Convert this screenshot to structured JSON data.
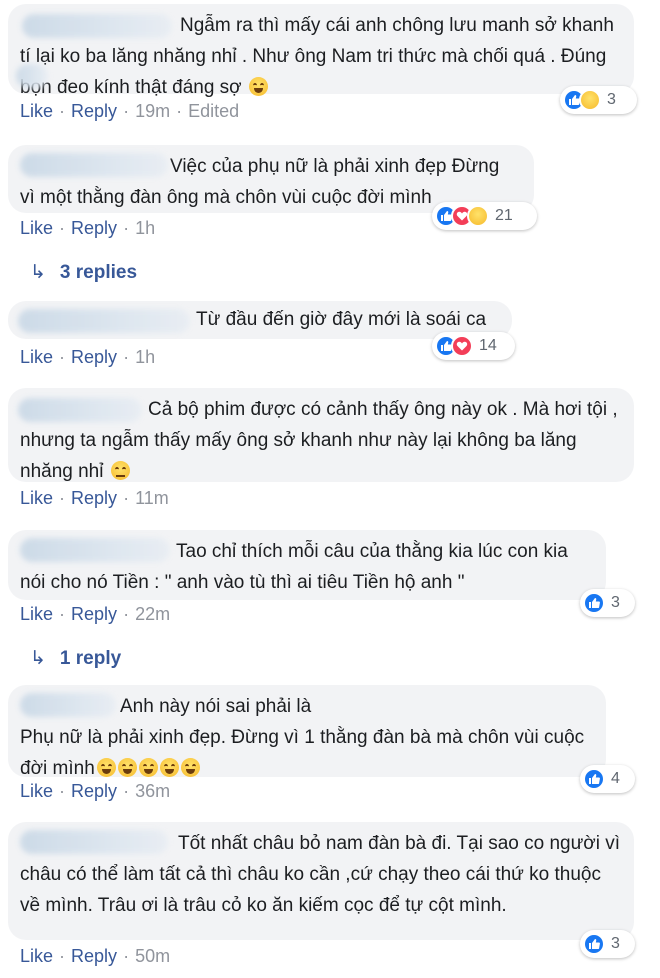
{
  "comments": [
    {
      "text": "Ngẫm ra thì mấy cái anh chông lưu manh sở khanh tí lại ko ba lăng nhăng nhỉ . Như ông Nam tri thức mà chối quá . Đúng bọn đeo kính thật đáng sợ",
      "like": "Like",
      "reply": "Reply",
      "time": "19m",
      "edited": "Edited",
      "reaction_count": "3",
      "reactions": [
        "like-icon",
        "haha-icon"
      ]
    },
    {
      "text": "Việc của phụ nữ là phải xinh đẹp Đừng vì một thằng đàn ông mà chôn vùi cuộc đời mình",
      "like": "Like",
      "reply": "Reply",
      "time": "1h",
      "reaction_count": "21",
      "reactions": [
        "like-icon",
        "love-icon",
        "haha-icon"
      ],
      "replies_label": "3 replies"
    },
    {
      "text": "Từ đầu đến giờ đây mới là soái ca",
      "like": "Like",
      "reply": "Reply",
      "time": "1h",
      "reaction_count": "14",
      "reactions": [
        "like-icon",
        "love-icon"
      ]
    },
    {
      "text": "Cả bộ phim được có cảnh thấy ông này ok . Mà hơi tội , nhưng ta ngẫm thấy mấy ông sở khanh như này lại không ba lăng nhăng nhỉ",
      "like": "Like",
      "reply": "Reply",
      "time": "11m"
    },
    {
      "text": "Tao chỉ thích mỗi câu của thằng kia lúc con kia nói cho nó Tiền : \" anh vào tù thì ai tiêu Tiền hộ anh \"",
      "like": "Like",
      "reply": "Reply",
      "time": "22m",
      "reaction_count": "3",
      "reactions": [
        "like-icon"
      ],
      "replies_label": "1 reply"
    },
    {
      "text_line1": "Anh này nói sai phải là",
      "text_line2": "Phụ nữ là phải xinh đẹp. Đừng vì 1 thằng đàn bà mà chôn vùi cuộc đời mình",
      "like": "Like",
      "reply": "Reply",
      "time": "36m",
      "reaction_count": "4",
      "reactions": [
        "like-icon"
      ]
    },
    {
      "text": "Tốt nhất châu bỏ nam đàn bà đi. Tại sao co người vì châu có thể làm tất cả thì châu ko cần ,cứ chạy theo cái thứ ko thuộc về mình. Trâu ơi là trâu cỏ ko ăn kiếm cọc để tự cột mình.",
      "like": "Like",
      "reply": "Reply",
      "time": "50m",
      "reaction_count": "3",
      "reactions": [
        "like-icon"
      ]
    }
  ],
  "colors": {
    "link": "#385898",
    "bubble": "#f2f3f5",
    "like": "#1877f2",
    "love": "#f33e58"
  }
}
